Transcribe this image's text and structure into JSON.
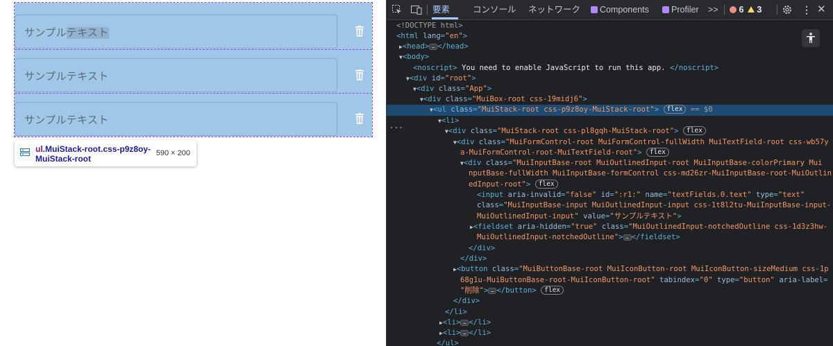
{
  "page": {
    "fields": [
      {
        "text": "サンプル",
        "selected_text": "テキスト"
      },
      {
        "text": "サンプルテキスト"
      },
      {
        "text": "サンプルテキスト"
      }
    ],
    "delete_label": "削除"
  },
  "tooltip": {
    "tag": "ul",
    "selector": ".MuiStack-root.css-p9z8oy-MuiStack-root",
    "size": "590 × 200"
  },
  "devtools": {
    "tabs": [
      "要素",
      "コンソール",
      "ネットワーク",
      "Components",
      "Profiler"
    ],
    "more": ">>",
    "errors": "6",
    "warnings": "3",
    "accent_color": "#a8c7fa",
    "error_color": "#f28b82",
    "warning_color": "#fdd663",
    "dom": {
      "l0": "<!DOCTYPE html>",
      "l1_tag": "<html ",
      "l1_attr": "lang",
      "l1_val": "\"en\"",
      "l1_end": ">",
      "l2": "<head>",
      "l2_end": "</head>",
      "l3": "<body>",
      "l4_open": "<noscript>",
      "l4_text": " You need to enable JavaScript to run this app. ",
      "l4_close": "</noscript>",
      "l5_tag": "<div ",
      "l5_attr": "id",
      "l5_val": "\"root\"",
      "l6_tag": "<div ",
      "l6_attr": "class",
      "l6_val": "\"App\"",
      "l7_tag": "<div ",
      "l7_attr": "class",
      "l7_val": "\"MuiBox-root css-19midj6\"",
      "l8_tag": "<ul ",
      "l8_attr": "class",
      "l8_val": "\"MuiStack-root css-p9z8oy-MuiStack-root\"",
      "l8_pill": "flex",
      "l8_eq": " == $0",
      "l9": "<li>",
      "l10_tag": "<div ",
      "l10_attr": "class",
      "l10_val": "\"MuiStack-root css-pl8gqh-MuiStack-root\"",
      "l10_pill": "flex",
      "l11_tag": "<div ",
      "l11_attr": "class",
      "l11_val_a": "\"MuiFormControl-root MuiFormControl-fullWidth MuiTextField-root css-wb57y",
      "l11_val_b": "a-MuiFormControl-root-MuiTextField-root\"",
      "l11_pill": "flex",
      "l12_tag": "<div ",
      "l12_attr": "class",
      "l12_val_a": "\"MuiInputBase-root MuiOutlinedInput-root MuiInputBase-colorPrimary Mui",
      "l12_val_b": "nputBase-fullWidth MuiInputBase-formControl css-md26zr-MuiInputBase-root-MuiOutlin",
      "l12_val_c": "edInput-root\"",
      "l12_pill": "flex",
      "l13_tag": "<input ",
      "l13_a1": "aria-invalid",
      "l13_v1": "\"false\"",
      "l13_a2": "id",
      "l13_v2": "\":r1:\"",
      "l13_a3": "name",
      "l13_v3": "\"textFields.0.text\"",
      "l13_a4": "type",
      "l13_v4": "\"text\"",
      "l14_attr": "class",
      "l14_val_a": "\"MuiInputBase-input MuiOutlinedInput-input css-1t8l2tu-MuiInputBase-input-",
      "l14_val_b": "MuiOutlinedInput-input\"",
      "l14_a2": "value",
      "l14_v2": "\"サンプルテキスト\"",
      "l15_tag": "<fieldset ",
      "l15_a1": "aria-hidden",
      "l15_v1": "\"true\"",
      "l15_a2": "class",
      "l15_v2": "\"MuiOutlinedInput-notchedOutline css-1d3z3hw-",
      "l15_val_b": "MuiOutlinedInput-notchedOutline\"",
      "l15_end": "</fieldset>",
      "close_div": "</div>",
      "l16_tag": "<button ",
      "l16_attr": "class",
      "l16_val_a": "\"MuiButtonBase-root MuiIconButton-root MuiIconButton-sizeMedium css-1p",
      "l16_val_b": "68g1u-MuiButtonBase-root-MuiIconButton-root\"",
      "l16_a2": "tabindex",
      "l16_v2": "\"0\"",
      "l16_a3": "type",
      "l16_v3": "\"button\"",
      "l16_a4": "aria-label",
      "l16_v4": "\"削除\"",
      "l16_end": "</button>",
      "l16_pill": "flex",
      "close_li": "</li>",
      "li_open": "<li>",
      "li_close": "</li>",
      "close_ul": "</ul>"
    }
  }
}
